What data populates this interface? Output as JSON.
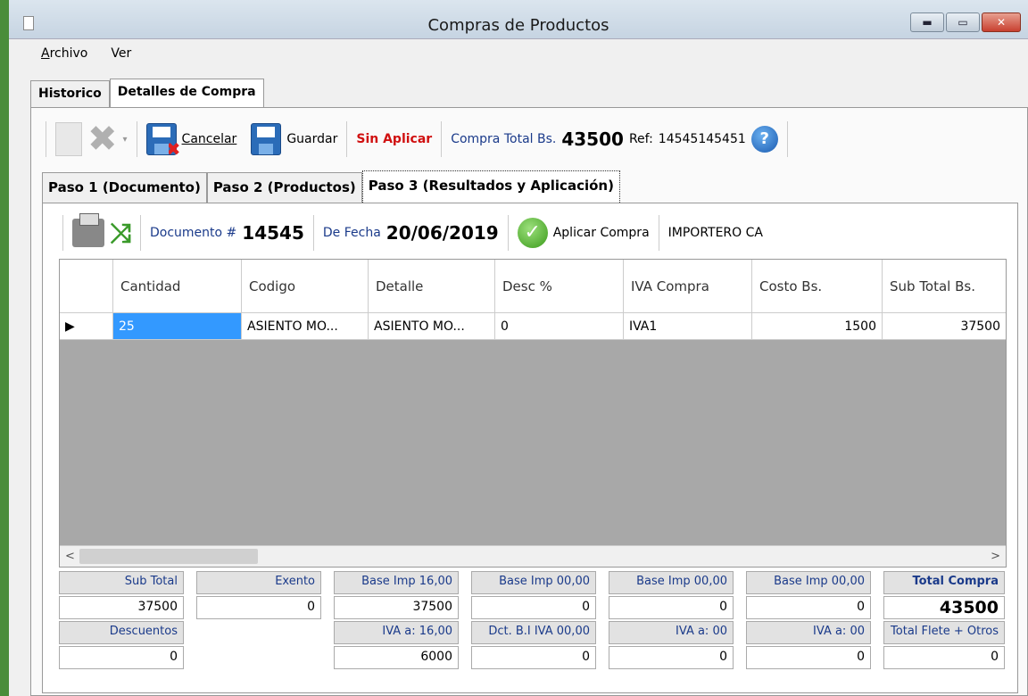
{
  "window": {
    "title": "Compras de Productos"
  },
  "menu": [
    {
      "label": "Archivo",
      "u": "A",
      "rest": "rchivo"
    },
    {
      "label": "Ver"
    }
  ],
  "tabs": [
    "Historico",
    "Detalles de Compra"
  ],
  "toolbar": {
    "cancel_label": "Cancelar",
    "save_label": "Guardar",
    "status": "Sin Aplicar",
    "total_label": "Compra Total Bs.",
    "total_value": "43500",
    "ref_label": "Ref:",
    "ref_value": "14545145451"
  },
  "steps": [
    "Paso 1 (Documento)",
    "Paso 2 (Productos)",
    "Paso 3 (Resultados y Aplicación)"
  ],
  "docbar": {
    "doc_label": "Documento #",
    "doc_value": "14545",
    "date_label": "De Fecha",
    "date_value": "20/06/2019",
    "apply_label": "Aplicar Compra",
    "supplier": "IMPORTERO CA"
  },
  "grid": {
    "columns": [
      "Cantidad",
      "Codigo",
      "Detalle",
      "Desc %",
      "IVA Compra",
      "Costo Bs.",
      "Sub Total Bs."
    ],
    "rows": [
      [
        "25",
        "ASIENTO MO...",
        "ASIENTO MO...",
        "0",
        "IVA1",
        "1500",
        "37500"
      ]
    ]
  },
  "totals": {
    "row1_labels": [
      "Sub Total",
      "Exento",
      "Base Imp 16,00",
      "Base Imp 00,00",
      "Base Imp 00,00",
      "Base Imp 00,00",
      "Total Compra"
    ],
    "row1_values": [
      "37500",
      "0",
      "37500",
      "0",
      "0",
      "0",
      "43500"
    ],
    "row2_labels": [
      "Descuentos",
      "IVA a: 16,00",
      "Dct. B.I IVA 00,00",
      "IVA a: 00",
      "IVA a: 00",
      "Total Flete + Otros"
    ],
    "row2_values": [
      "0",
      "6000",
      "0",
      "0",
      "0",
      "0"
    ]
  }
}
